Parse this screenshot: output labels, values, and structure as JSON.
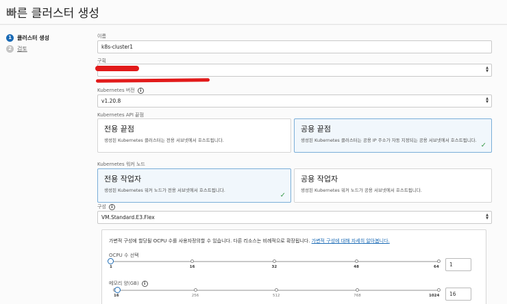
{
  "page": {
    "title": "빠른 클러스터 생성"
  },
  "steps": [
    {
      "number": "1",
      "label": "클러스터 생성",
      "state": "active"
    },
    {
      "number": "2",
      "label": "검토",
      "state": "inactive"
    }
  ],
  "form": {
    "name": {
      "label": "이름",
      "value": "k8s-cluster1"
    },
    "compartment": {
      "label": "구획",
      "value": ""
    },
    "k8s_version": {
      "label": "Kubernetes 버전",
      "value": "v1.20.8"
    },
    "api_endpoint": {
      "label": "Kubernetes API 끝점",
      "options": [
        {
          "title": "전용 끝점",
          "desc": "생성된 Kubernetes 클러스터는 전용 서브넷에서 호스트됩니다.",
          "selected": false
        },
        {
          "title": "공용 끝점",
          "desc": "생성된 Kubernetes 클러스터는 공용 IP 주소가 자동 지정되는 공용 서브넷에서 호스트됩니다.",
          "selected": true
        }
      ]
    },
    "worker_nodes": {
      "label": "Kubernetes 워커 노드",
      "options": [
        {
          "title": "전용 작업자",
          "desc": "생성된 Kubernetes 워커 노드가 전용 서브넷에서 호스트됩니다.",
          "selected": true
        },
        {
          "title": "공용 작업자",
          "desc": "생성된 Kubernetes 워커 노드가 공용 서브넷에서 호스트됩니다.",
          "selected": false
        }
      ]
    },
    "shape": {
      "label": "구성",
      "value": "VM.Standard.E3.Flex"
    },
    "flex": {
      "desc": "가변적 구성에 할당될 OCPU 수를 사용자정의할 수 있습니다. 다른 리소스는 비례적으로 확장됩니다.",
      "link": "가변적 구성에 대해 자세히 알아봅니다.",
      "ocpu": {
        "label": "OCPU 수 선택",
        "ticks": [
          "1",
          "16",
          "32",
          "48",
          "64"
        ],
        "value": "1",
        "fraction": 0
      },
      "memory": {
        "label": "메모리 양(GB)",
        "ticks": [
          "16",
          "256",
          "512",
          "768",
          "1024"
        ],
        "value": "16",
        "fraction": 0.01
      }
    }
  },
  "colors": {
    "accent": "#1a6ab5",
    "check": "#3a9a4c",
    "redaction": "#e21a1a"
  },
  "icons": {
    "info": "info-icon",
    "select": "select-arrows-icon",
    "check": "check-icon"
  }
}
